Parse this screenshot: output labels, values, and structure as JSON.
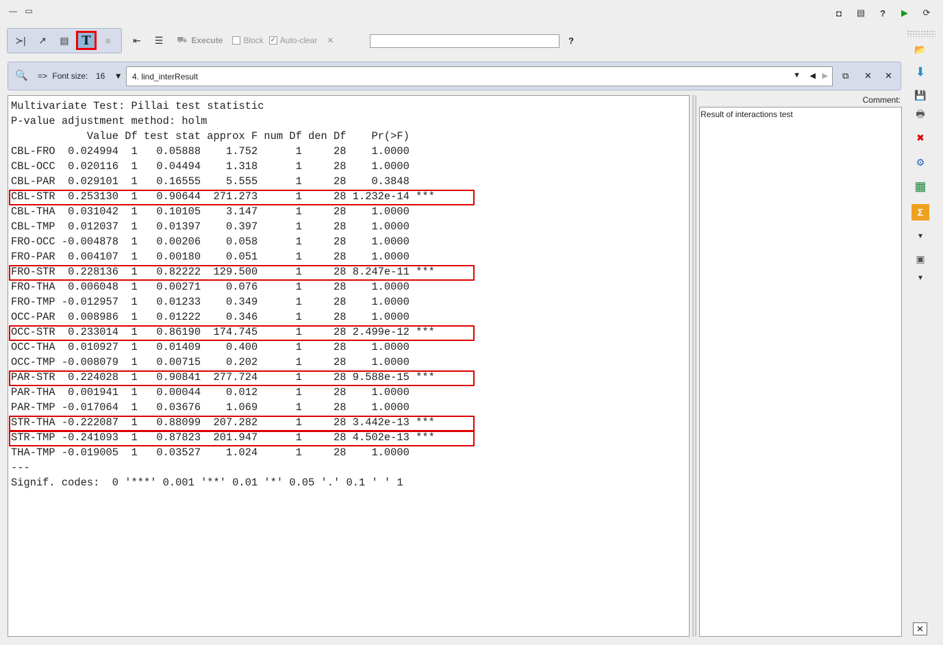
{
  "window": {
    "minimize_glyph": "—",
    "restore_glyph": "▭"
  },
  "top_icons": [
    {
      "name": "record-icon",
      "glyph": "◘"
    },
    {
      "name": "window-icon",
      "glyph": "▤"
    },
    {
      "name": "help-icon",
      "glyph": "?"
    },
    {
      "name": "run-icon",
      "glyph": "▶"
    },
    {
      "name": "refresh-icon",
      "glyph": "⟳"
    }
  ],
  "toolbar": {
    "mode_buttons": [
      {
        "name": "console-mode-button",
        "glyph": "≻|"
      },
      {
        "name": "graph-mode-button",
        "glyph": "↗"
      },
      {
        "name": "table-mode-button",
        "glyph": "▤"
      },
      {
        "name": "text-mode-button",
        "glyph": "T"
      },
      {
        "name": "gray-mode-button",
        "glyph": "■"
      }
    ],
    "execute_label": "Execute",
    "block_label": "Block",
    "autoclear_label": "Auto-clear",
    "autoclear_checked": "✓",
    "clear_glyph": "✕",
    "command_value": "",
    "help_label": "?"
  },
  "output_bar": {
    "arrow_label": "=>",
    "font_size_label": "Font size:",
    "font_size_value": "16",
    "selected_output": "4. lind_interResult"
  },
  "output_lines": [
    {
      "text": "Multivariate Test: Pillai test statistic",
      "highlight": false
    },
    {
      "text": "P-value adjustment method: holm",
      "highlight": false
    },
    {
      "text": "            Value Df test stat approx F num Df den Df    Pr(>F)    ",
      "highlight": false
    },
    {
      "text": "CBL-FRO  0.024994  1   0.05888    1.752      1     28    1.0000    ",
      "highlight": false
    },
    {
      "text": "CBL-OCC  0.020116  1   0.04494    1.318      1     28    1.0000    ",
      "highlight": false
    },
    {
      "text": "CBL-PAR  0.029101  1   0.16555    5.555      1     28    0.3848    ",
      "highlight": false
    },
    {
      "text": "CBL-STR  0.253130  1   0.90644  271.273      1     28 1.232e-14 ***",
      "highlight": true
    },
    {
      "text": "CBL-THA  0.031042  1   0.10105    3.147      1     28    1.0000    ",
      "highlight": false
    },
    {
      "text": "CBL-TMP  0.012037  1   0.01397    0.397      1     28    1.0000    ",
      "highlight": false
    },
    {
      "text": "FRO-OCC -0.004878  1   0.00206    0.058      1     28    1.0000    ",
      "highlight": false
    },
    {
      "text": "FRO-PAR  0.004107  1   0.00180    0.051      1     28    1.0000    ",
      "highlight": false
    },
    {
      "text": "FRO-STR  0.228136  1   0.82222  129.500      1     28 8.247e-11 ***",
      "highlight": true
    },
    {
      "text": "FRO-THA  0.006048  1   0.00271    0.076      1     28    1.0000    ",
      "highlight": false
    },
    {
      "text": "FRO-TMP -0.012957  1   0.01233    0.349      1     28    1.0000    ",
      "highlight": false
    },
    {
      "text": "OCC-PAR  0.008986  1   0.01222    0.346      1     28    1.0000    ",
      "highlight": false
    },
    {
      "text": "OCC-STR  0.233014  1   0.86190  174.745      1     28 2.499e-12 ***",
      "highlight": true
    },
    {
      "text": "OCC-THA  0.010927  1   0.01409    0.400      1     28    1.0000    ",
      "highlight": false
    },
    {
      "text": "OCC-TMP -0.008079  1   0.00715    0.202      1     28    1.0000    ",
      "highlight": false
    },
    {
      "text": "PAR-STR  0.224028  1   0.90841  277.724      1     28 9.588e-15 ***",
      "highlight": true
    },
    {
      "text": "PAR-THA  0.001941  1   0.00044    0.012      1     28    1.0000    ",
      "highlight": false
    },
    {
      "text": "PAR-TMP -0.017064  1   0.03676    1.069      1     28    1.0000    ",
      "highlight": false
    },
    {
      "text": "STR-THA -0.222087  1   0.88099  207.282      1     28 3.442e-13 ***",
      "highlight": true
    },
    {
      "text": "STR-TMP -0.241093  1   0.87823  201.947      1     28 4.502e-13 ***",
      "highlight": true
    },
    {
      "text": "THA-TMP -0.019005  1   0.03527    1.024      1     28    1.0000    ",
      "highlight": false
    },
    {
      "text": "---",
      "highlight": false
    },
    {
      "text": "Signif. codes:  0 '***' 0.001 '**' 0.01 '*' 0.05 '.' 0.1 ' ' 1",
      "highlight": false
    }
  ],
  "comment": {
    "label": "Comment:",
    "text": "Result of interactions test"
  },
  "right_icons": [
    {
      "name": "open-folder-icon",
      "glyph": "📂"
    },
    {
      "name": "download-icon",
      "glyph": "⬇"
    },
    {
      "name": "save-icon",
      "glyph": "💾"
    },
    {
      "name": "print-icon",
      "glyph": "🖶"
    },
    {
      "name": "delete-icon",
      "glyph": "✖"
    },
    {
      "name": "settings-icon",
      "glyph": "⚙"
    },
    {
      "name": "table-icon",
      "glyph": "▦"
    },
    {
      "name": "sum-icon",
      "glyph": "Σ"
    },
    {
      "name": "dropdown-icon",
      "glyph": "▾"
    },
    {
      "name": "stack-icon",
      "glyph": "▣"
    },
    {
      "name": "dropdown-icon-2",
      "glyph": "▾"
    }
  ],
  "close_glyph": "✕",
  "colors": {
    "highlight": "#dd0000",
    "panel": "#d6dcea",
    "active_mode": "#8fb8d8"
  }
}
